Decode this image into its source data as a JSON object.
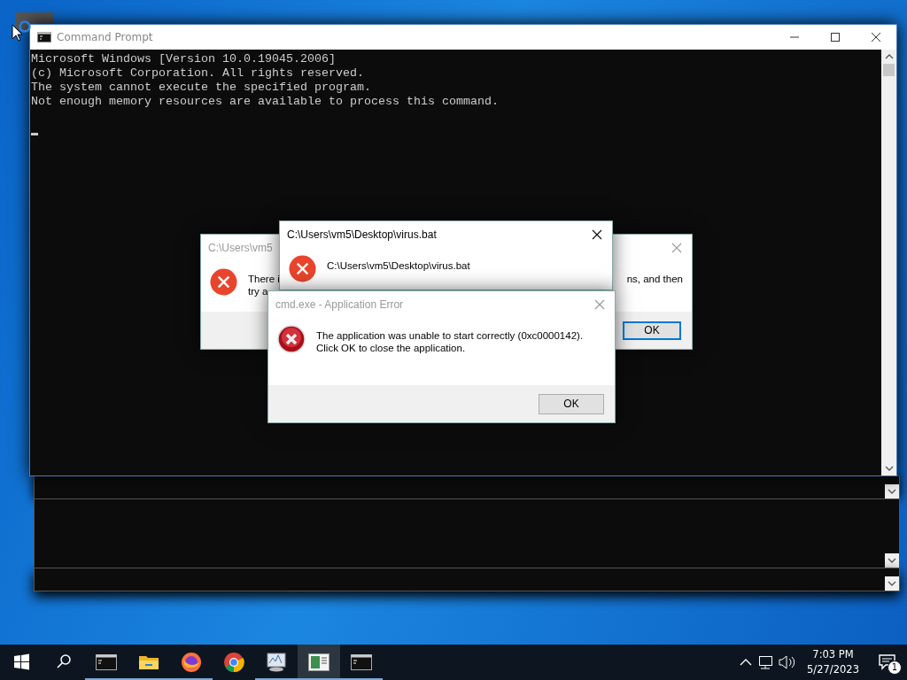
{
  "console": {
    "title": "Command Prompt",
    "lines": [
      "Microsoft Windows [Version 10.0.19045.2006]",
      "(c) Microsoft Corporation. All rights reserved.",
      "The system cannot execute the specified program.",
      "Not enough memory resources are available to process this command."
    ]
  },
  "dialogs": [
    {
      "kind": "modern",
      "title": "C:\\Users\\vm5",
      "active": false,
      "line_start": "There i",
      "line_end": "ns, and then",
      "line_2": "try a",
      "button": "OK",
      "default": true
    },
    {
      "kind": "modern",
      "title": "C:\\Users\\vm5\\Desktop\\virus.bat",
      "active": true,
      "message": "C:\\Users\\vm5\\Desktop\\virus.bat"
    },
    {
      "kind": "classic",
      "title": "cmd.exe - Application Error",
      "active": false,
      "message": "The application was unable to start correctly (0xc0000142).",
      "message_2": "Click OK to close the application.",
      "button": "OK",
      "default": false
    }
  ],
  "taskbar": {
    "apps": [
      {
        "kind": "console",
        "running": true,
        "selected": false
      },
      {
        "kind": "folder",
        "running": true,
        "selected": false
      },
      {
        "kind": "firefox",
        "running": true,
        "selected": false
      },
      {
        "kind": "chrome",
        "running": false,
        "selected": false
      },
      {
        "kind": "monitor",
        "running": true,
        "selected": false
      },
      {
        "kind": "sheet",
        "running": true,
        "selected": true
      },
      {
        "kind": "console",
        "running": true,
        "selected": false
      }
    ],
    "time": "7:03 PM",
    "date": "5/27/2023",
    "notifications": "1"
  }
}
